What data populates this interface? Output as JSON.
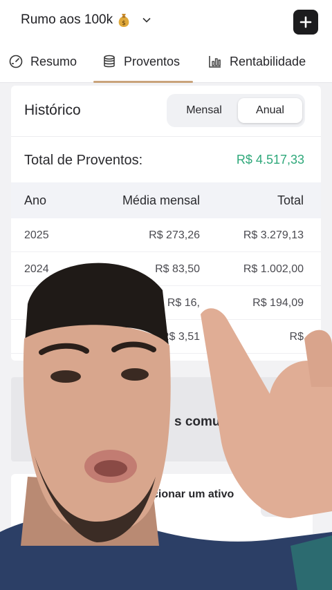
{
  "header": {
    "portfolio_name": "Rumo aos 100k",
    "portfolio_icon": "money-bag-icon",
    "add_icon": "plus-icon"
  },
  "tabs": [
    {
      "label": "Resumo",
      "icon": "gauge-icon"
    },
    {
      "label": "Proventos",
      "icon": "coins-stack-icon",
      "active": true
    },
    {
      "label": "Rentabilidade",
      "icon": "bar-chart-icon"
    }
  ],
  "historico": {
    "title": "Histórico",
    "toggle": {
      "options": [
        "Mensal",
        "Anual"
      ],
      "selected": "Anual"
    },
    "total_label": "Total de Proventos:",
    "total_value": "R$ 4.517,33",
    "columns": [
      "Ano",
      "Média mensal",
      "Total"
    ],
    "rows": [
      {
        "ano": "2025",
        "media": "R$ 273,26",
        "total": "R$ 3.279,13"
      },
      {
        "ano": "2024",
        "media": "R$ 83,50",
        "total": "R$ 1.002,00"
      },
      {
        "ano": "",
        "media": "R$ 16,",
        "total": "R$ 194,09"
      },
      {
        "ano": "",
        "media": "R$ 3,51",
        "total": "R$"
      }
    ]
  },
  "secondary_card": {
    "title": "s comuns"
  },
  "add_asset_card": {
    "text": "cionar um ativo",
    "button_icon": "arrow-down-icon"
  },
  "colors": {
    "accent_underline": "#c9a37a",
    "positive_green": "#2ea87a",
    "dark_button": "#1c1c1e"
  }
}
